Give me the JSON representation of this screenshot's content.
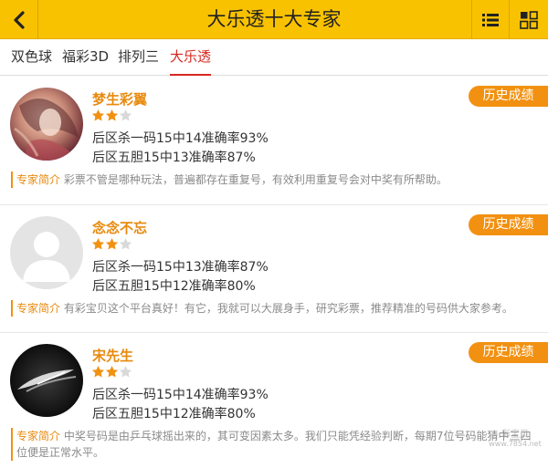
{
  "header": {
    "title": "大乐透十大专家",
    "back_icon": "chevron-left-icon",
    "list_icon": "list-icon",
    "grid_icon": "grid-icon"
  },
  "tabs": [
    {
      "label": "双色球",
      "active": false
    },
    {
      "label": "福彩3D",
      "active": false
    },
    {
      "label": "排列三",
      "active": false
    },
    {
      "label": "大乐透",
      "active": true
    }
  ],
  "experts": [
    {
      "name": "梦生彩翼",
      "rating": 2,
      "max_rating": 3,
      "stats": [
        "后区杀一码15中14准确率93%",
        "后区五胆15中13准确率87%"
      ],
      "history_label": "历史成绩",
      "intro_label": "专家简介",
      "intro_text": "彩票不管是哪种玩法，普遍都存在重复号，有效利用重复号会对中奖有所帮助。"
    },
    {
      "name": "念念不忘",
      "rating": 2,
      "max_rating": 3,
      "stats": [
        "后区杀一码15中13准确率87%",
        "后区五胆15中12准确率80%"
      ],
      "history_label": "历史成绩",
      "intro_label": "专家简介",
      "intro_text": "有彩宝贝这个平台真好！有它，我就可以大展身手，研究彩票，推荐精准的号码供大家参考。"
    },
    {
      "name": "宋先生",
      "rating": 2,
      "max_rating": 3,
      "stats": [
        "后区杀一码15中14准确率93%",
        "后区五胆15中12准确率80%"
      ],
      "history_label": "历史成绩",
      "intro_label": "专家简介",
      "intro_text": "中奖号码是由乒乓球摇出来的，其可变因素太多。我们只能凭经验判断，每期7位号码能猜中三四位便是正常水平。"
    }
  ],
  "watermark": {
    "line1": "彩宝贝",
    "line2": "www.7854.net"
  },
  "colors": {
    "header_bg": "#f9c200",
    "accent_orange": "#f29111",
    "name_color": "#e88a0e",
    "active_tab": "#d6281f"
  }
}
